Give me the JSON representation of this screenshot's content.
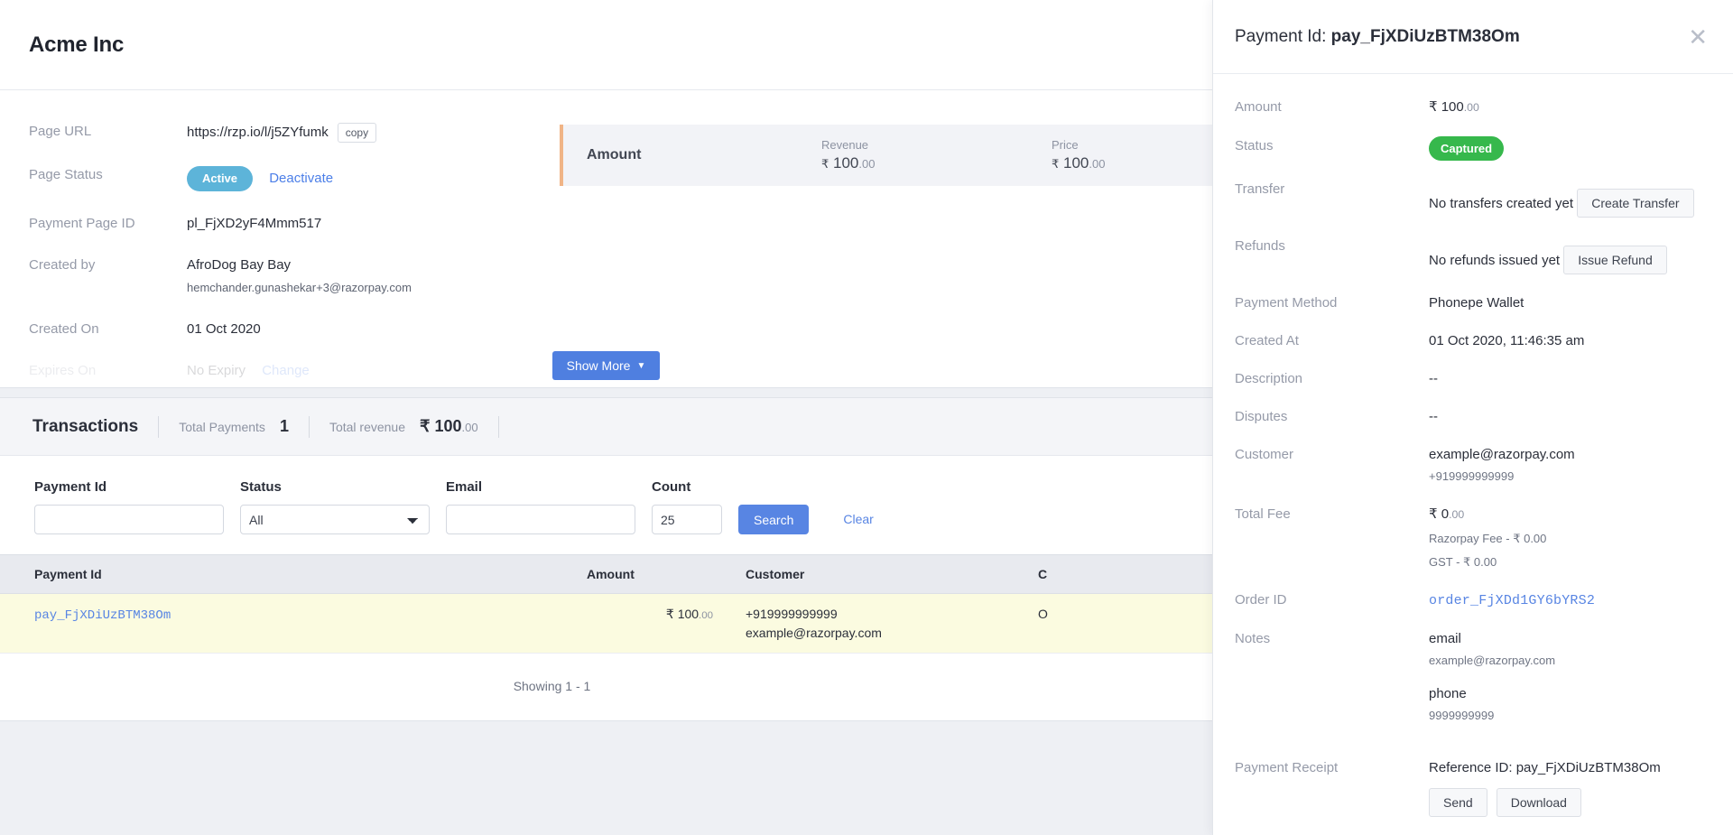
{
  "header": {
    "title": "Acme Inc"
  },
  "details": {
    "rows": [
      {
        "label": "Page URL",
        "value": "https://rzp.io/l/j5ZYfumk",
        "copy_label": "copy"
      },
      {
        "label": "Page Status",
        "value": "Active",
        "action": "Deactivate"
      },
      {
        "label": "Payment Page ID",
        "value": "pl_FjXD2yF4Mmm517"
      },
      {
        "label": "Created by",
        "value": "AfroDog Bay Bay",
        "sub": "hemchander.gunashekar+3@razorpay.com"
      },
      {
        "label": "Created On",
        "value": "01 Oct 2020"
      },
      {
        "label": "Expires On",
        "value": "No Expiry",
        "action": "Change"
      }
    ],
    "stats": {
      "title": "Amount",
      "columns": [
        {
          "key": "Revenue",
          "currency": "₹",
          "whole": "100",
          "decimals": ".00"
        },
        {
          "key": "Price",
          "currency": "₹",
          "whole": "100",
          "decimals": ".00"
        }
      ]
    },
    "show_more_label": "Show More"
  },
  "transactions": {
    "title": "Transactions",
    "summary": [
      {
        "key": "Total Payments",
        "value": "1",
        "decimals": ""
      },
      {
        "key": "Total revenue",
        "value": "₹ 100",
        "decimals": ".00"
      }
    ],
    "filters": {
      "payment_id": {
        "label": "Payment Id",
        "value": "",
        "placeholder": ""
      },
      "status": {
        "label": "Status",
        "value": "All",
        "options": [
          "All"
        ]
      },
      "email": {
        "label": "Email",
        "value": "",
        "placeholder": ""
      },
      "count": {
        "label": "Count",
        "value": "25",
        "placeholder": ""
      },
      "search_label": "Search",
      "clear_label": "Clear"
    },
    "table": {
      "columns": [
        "Payment Id",
        "Amount",
        "Customer",
        "C"
      ],
      "rows": [
        {
          "payment_id": "pay_FjXDiUzBTM38Om",
          "amount": "₹ 100",
          "amount_dec": ".00",
          "customer_phone": "+919999999999",
          "customer_email": "example@razorpay.com",
          "created": "O"
        }
      ]
    },
    "showing": "Showing 1 - 1"
  },
  "drawer": {
    "title_prefix": "Payment Id: ",
    "title_id": "pay_FjXDiUzBTM38Om",
    "close_icon": "✕",
    "amount": {
      "label": "Amount",
      "value": "₹ 100",
      "decimals": ".00"
    },
    "status": {
      "label": "Status",
      "value": "Captured"
    },
    "transfer": {
      "label": "Transfer",
      "value": "No transfers created yet",
      "button": "Create Transfer"
    },
    "refunds": {
      "label": "Refunds",
      "value": "No refunds issued yet",
      "button": "Issue Refund"
    },
    "payment_method": {
      "label": "Payment Method",
      "value": "Phonepe Wallet"
    },
    "created_at": {
      "label": "Created At",
      "value": "01 Oct 2020, 11:46:35 am"
    },
    "description": {
      "label": "Description",
      "value": "--"
    },
    "disputes": {
      "label": "Disputes",
      "value": "--"
    },
    "customer": {
      "label": "Customer",
      "value": "example@razorpay.com",
      "sub": "+919999999999"
    },
    "total_fee": {
      "label": "Total Fee",
      "value": "₹ 0",
      "decimals": ".00",
      "razorpay_fee": "Razorpay Fee - ₹ 0.00",
      "gst": "GST - ₹ 0.00"
    },
    "order_id": {
      "label": "Order ID",
      "value": "order_FjXDd1GY6bYRS2"
    },
    "notes": {
      "label": "Notes",
      "items": [
        {
          "key": "email",
          "value": "example@razorpay.com"
        },
        {
          "key": "phone",
          "value": "9999999999"
        }
      ]
    },
    "receipt": {
      "label": "Payment Receipt",
      "reference": "Reference ID: pay_FjXDiUzBTM38Om",
      "send_label": "Send",
      "download_label": "Download"
    }
  },
  "colors": {
    "accent_blue": "#5885e3",
    "status_active": "#5db4d9",
    "status_captured": "#36b84c",
    "stat_bar": "#f0b486",
    "row_highlight": "#fbfbe0"
  }
}
